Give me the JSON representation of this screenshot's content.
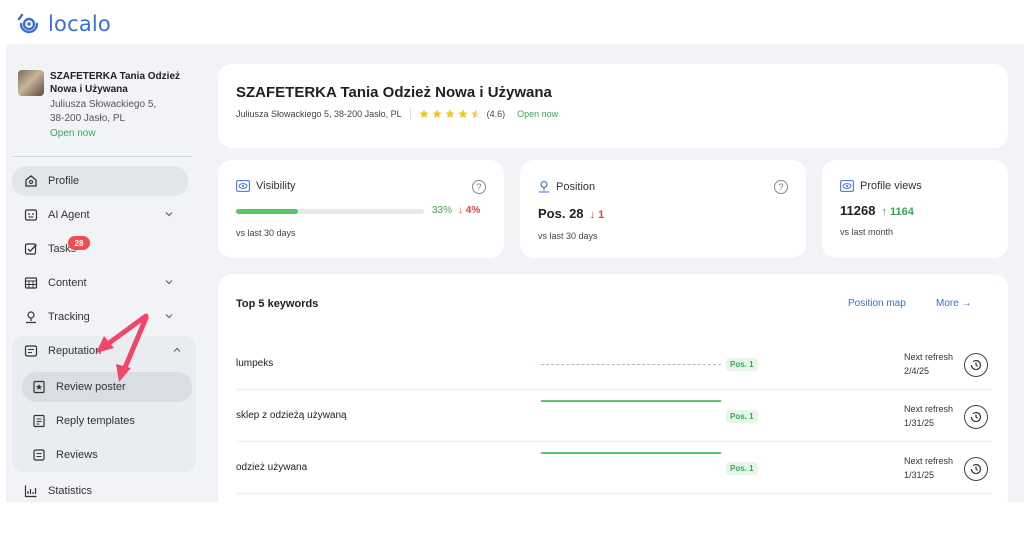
{
  "brand": {
    "name": "localo",
    "accent": "#3b6fd6"
  },
  "business": {
    "name": "SZAFETERKA Tania Odzież Nowa i Używana",
    "address_line1": "Juliusza Słowackiego 5,",
    "address_line2": "38-200 Jasło, PL",
    "status": "Open now",
    "full_address": "Juliusza Słowackiego 5, 38-200 Jasło, PL",
    "rating": "(4.6)",
    "stars": 4.5
  },
  "sidebar": {
    "items": [
      {
        "label": "Profile",
        "icon": "home-icon",
        "active": true
      },
      {
        "label": "AI Agent",
        "icon": "robot-icon"
      },
      {
        "label": "Tasks",
        "icon": "checkbox-icon",
        "badge": "28"
      },
      {
        "label": "Content",
        "icon": "calendar-icon"
      },
      {
        "label": "Tracking",
        "icon": "location-pin-icon"
      },
      {
        "label": "Reputation",
        "icon": "review-icon",
        "expanded": true
      },
      {
        "label": "Statistics",
        "icon": "chart-icon"
      }
    ],
    "reputation_sub": [
      {
        "label": "Review poster",
        "icon": "star-poster-icon",
        "active": true
      },
      {
        "label": "Reply templates",
        "icon": "template-icon"
      },
      {
        "label": "Reviews",
        "icon": "reviews-icon"
      }
    ]
  },
  "stats": {
    "visibility": {
      "title": "Visibility",
      "percent": "33%",
      "fill": 0.33,
      "change": "↓ 4%",
      "compare": "vs last 30 days"
    },
    "position": {
      "title": "Position",
      "value": "Pos. 28",
      "change": "↓ 1",
      "compare": "vs last 30 days"
    },
    "views": {
      "title": "Profile views",
      "value": "11268",
      "change": "↑ 1164",
      "compare": "vs last month"
    },
    "help_symbol": "?"
  },
  "keywords": {
    "title": "Top 5 keywords",
    "position_map": "Position map",
    "more": "More →",
    "refresh_label": "Next refresh",
    "rows": [
      {
        "keyword": "lumpeks",
        "pos": "Pos. 1",
        "date": "2/4/25",
        "line": "dashed"
      },
      {
        "keyword": "sklep z odzieżą używaną",
        "pos": "Pos. 1",
        "date": "1/31/25",
        "line": "solid"
      },
      {
        "keyword": "odzież używana",
        "pos": "Pos. 1",
        "date": "1/31/25",
        "line": "solid"
      }
    ]
  },
  "colors": {
    "green": "#3aa655",
    "red": "#e24343",
    "annotation_arrow": "#f0466a"
  }
}
